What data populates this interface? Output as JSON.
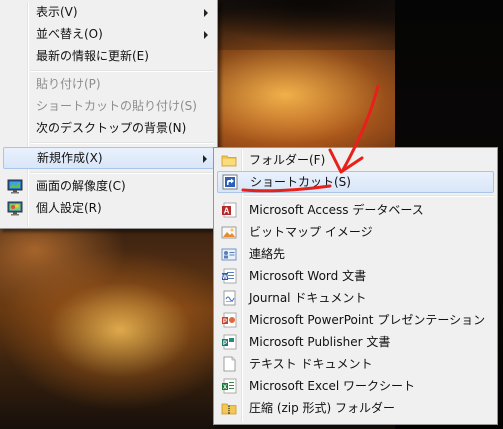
{
  "main_menu": {
    "items": [
      {
        "label": "表示(V)",
        "has_submenu": true,
        "disabled": false
      },
      {
        "label": "並べ替え(O)",
        "has_submenu": true,
        "disabled": false
      },
      {
        "label": "最新の情報に更新(E)",
        "has_submenu": false,
        "disabled": false
      },
      {
        "label": "貼り付け(P)",
        "has_submenu": false,
        "disabled": true
      },
      {
        "label": "ショートカットの貼り付け(S)",
        "has_submenu": false,
        "disabled": true
      },
      {
        "label": "次のデスクトップの背景(N)",
        "has_submenu": false,
        "disabled": false
      },
      {
        "label": "新規作成(X)",
        "has_submenu": true,
        "disabled": false,
        "highlighted": true
      },
      {
        "label": "画面の解像度(C)",
        "has_submenu": false,
        "disabled": false,
        "icon": "display-icon"
      },
      {
        "label": "個人設定(R)",
        "has_submenu": false,
        "disabled": false,
        "icon": "personalize-icon"
      }
    ]
  },
  "new_submenu": {
    "items": [
      {
        "label": "フォルダー(F)",
        "icon": "folder-icon"
      },
      {
        "label": "ショートカット(S)",
        "icon": "shortcut-icon",
        "highlighted": true
      },
      {
        "label": "Microsoft Access データベース",
        "icon": "access-icon"
      },
      {
        "label": "ビットマップ イメージ",
        "icon": "bitmap-icon"
      },
      {
        "label": "連絡先",
        "icon": "contact-icon"
      },
      {
        "label": "Microsoft Word 文書",
        "icon": "word-icon"
      },
      {
        "label": "Journal ドキュメント",
        "icon": "journal-icon"
      },
      {
        "label": "Microsoft PowerPoint プレゼンテーション",
        "icon": "powerpoint-icon"
      },
      {
        "label": "Microsoft Publisher 文書",
        "icon": "publisher-icon"
      },
      {
        "label": "テキスト ドキュメント",
        "icon": "text-document-icon"
      },
      {
        "label": "Microsoft Excel ワークシート",
        "icon": "excel-icon"
      },
      {
        "label": "圧縮 (zip 形式) フォルダー",
        "icon": "zip-folder-icon"
      }
    ]
  },
  "colors": {
    "menu_bg": "#f0f0f0",
    "highlight_bg": "#dbe8f8",
    "highlight_border": "#a9c5e8",
    "annotation_red": "#e8201a"
  }
}
